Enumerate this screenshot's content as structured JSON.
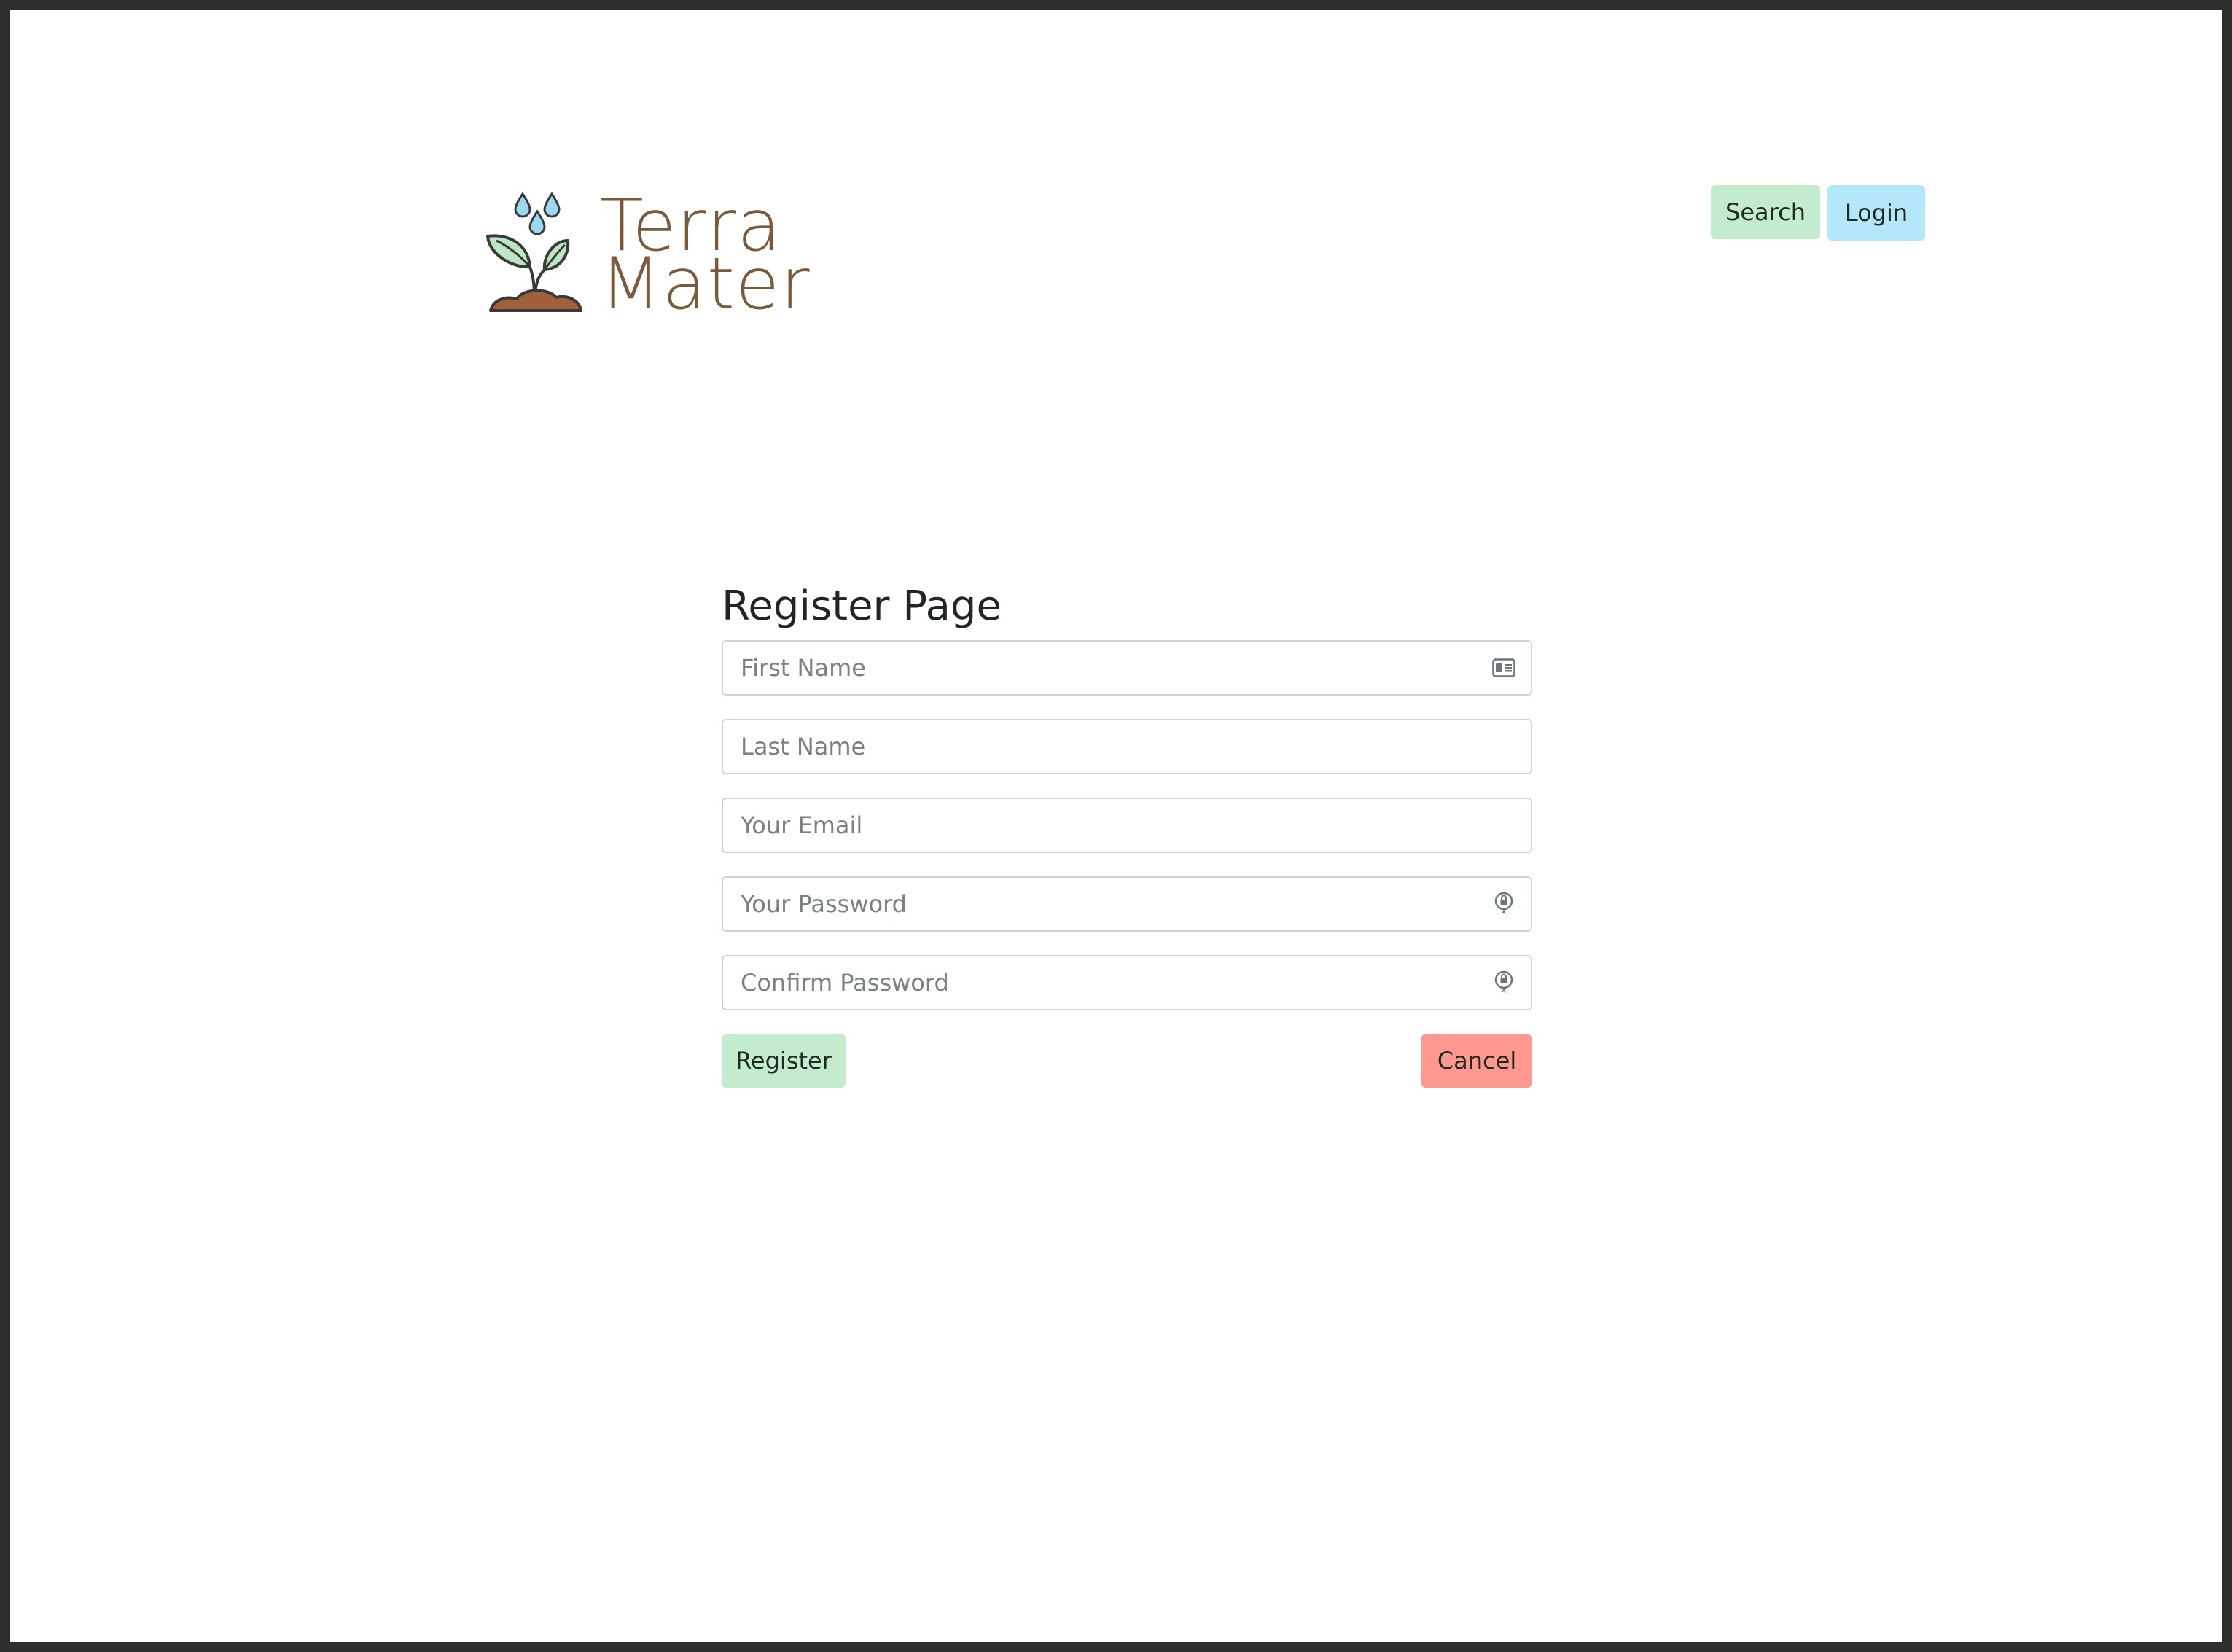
{
  "brand": {
    "name_line1": "Terra",
    "name_line2": "Mater",
    "text_color": "#7b5a3c",
    "leaf_color": "#bde6c2",
    "soil_color": "#a0603a",
    "drop_color": "#9ad9ee"
  },
  "nav": {
    "search_label": "Search",
    "login_label": "Login",
    "search_color": "#c3ebcd",
    "login_color": "#b5e7fb"
  },
  "form": {
    "title": "Register Page",
    "fields": [
      {
        "placeholder": "First Name",
        "value": "",
        "icon": "id-card-icon"
      },
      {
        "placeholder": "Last Name",
        "value": ""
      },
      {
        "placeholder": "Your Email",
        "value": ""
      },
      {
        "placeholder": "Your Password",
        "value": "",
        "icon": "password-key-icon"
      },
      {
        "placeholder": "Confirm Password",
        "value": "",
        "icon": "password-key-icon"
      }
    ],
    "register_label": "Register",
    "cancel_label": "Cancel",
    "register_color": "#c3ebcd",
    "cancel_color": "#ff9990"
  }
}
